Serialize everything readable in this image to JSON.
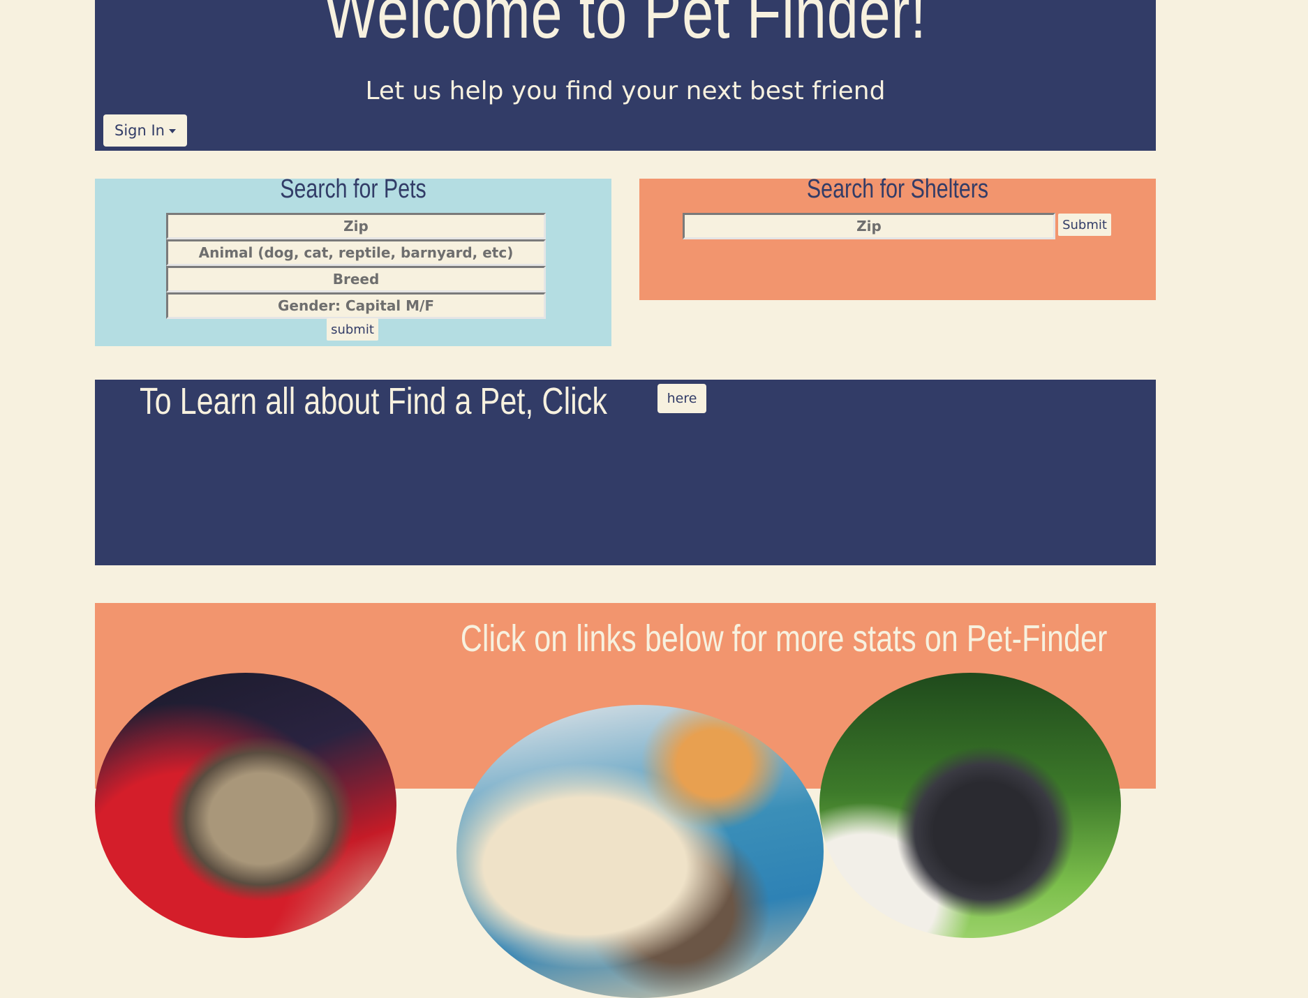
{
  "header": {
    "title": "Welcome to Pet Finder!",
    "subtitle": "Let us help you find your next best friend",
    "signin_label": "Sign In"
  },
  "pets_search": {
    "title": "Search for Pets",
    "zip_placeholder": "Zip",
    "animal_placeholder": "Animal (dog, cat, reptile, barnyard, etc)",
    "breed_placeholder": "Breed",
    "gender_placeholder": "Gender: Capital M/F",
    "submit_label": "submit"
  },
  "shelters_search": {
    "title": "Search for Shelters",
    "zip_placeholder": "Zip",
    "submit_label": "Submit"
  },
  "learn": {
    "text": "To Learn all about Find a Pet, Click",
    "button_label": "here"
  },
  "stats": {
    "text": "Click on links below for more stats on Pet-Finder"
  },
  "colors": {
    "navy": "#323c67",
    "cream": "#f7f1df",
    "light_blue": "#b4dde2",
    "salmon": "#f2956e"
  }
}
